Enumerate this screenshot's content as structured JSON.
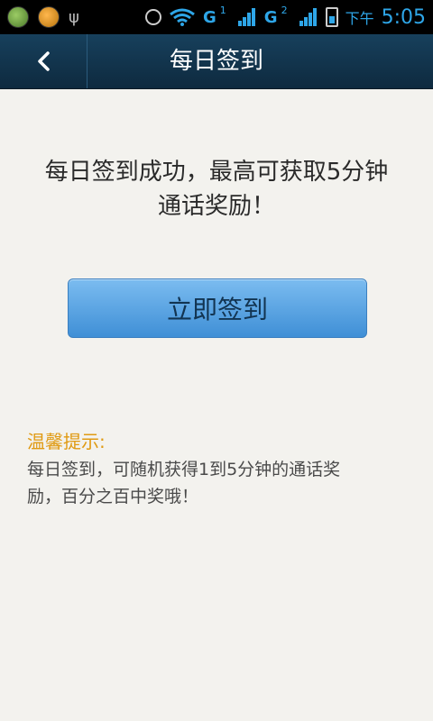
{
  "status_bar": {
    "network_1": "G",
    "sim_1": "1",
    "network_2": "G",
    "sim_2": "2",
    "time_prefix": "下午",
    "time": "5:05"
  },
  "header": {
    "title": "每日签到"
  },
  "main": {
    "headline_line1": "每日签到成功，最高可获取5分钟",
    "headline_line2": "通话奖励！",
    "checkin_button_label": "立即签到",
    "tip_heading": "温馨提示:",
    "tip_line1": "每日签到，可随机获得1到5分钟的通话奖",
    "tip_line2": "励，百分之百中奖哦！"
  },
  "colors": {
    "title_bar": "#0e2a3f",
    "button": "#4a98db",
    "tip_heading": "#e09a12",
    "background": "#f3f2ee"
  }
}
